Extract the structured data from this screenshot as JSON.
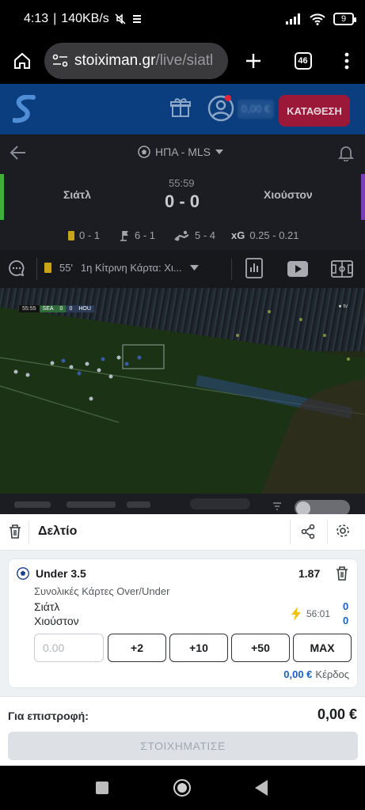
{
  "status_bar": {
    "time": "4:13",
    "speed": "140KB/s",
    "battery": "9"
  },
  "browser": {
    "url_host": "stoiximan.gr",
    "url_path": "/live/siatl",
    "tabs_count": "46"
  },
  "site_header": {
    "deposit_label": "ΚΑΤΑΘΕΣΗ",
    "balance": "0,00 €"
  },
  "event": {
    "league": "ΗΠΑ - MLS",
    "home_team": "Σιάτλ",
    "away_team": "Χιούστον",
    "time": "55:59",
    "score": "0 - 0",
    "stats": {
      "yellow_cards": "0 - 1",
      "corners": "6 - 1",
      "offsides": "5 - 4",
      "xg_label": "xG",
      "xg_value": "0.25 - 0.21"
    },
    "last_event": {
      "minute": "55'",
      "text": "1η Κίτρινη Κάρτα: Χι..."
    },
    "video_overlay": {
      "time": "55:55",
      "home": "SEA",
      "home_score": "0",
      "away_score": "0",
      "away": "HOU"
    }
  },
  "slip": {
    "title": "Δελτίο",
    "bet": {
      "selection": "Under 3.5",
      "odds": "1.87",
      "market": "Συνολικές Κάρτες Over/Under",
      "home_team": "Σιάτλ",
      "away_team": "Χιούστον",
      "live_time": "56:01",
      "home_score": "0",
      "away_score": "0",
      "stake_placeholder": "0.00",
      "quick_stakes": [
        "+2",
        "+10",
        "+50",
        "MAX"
      ],
      "potential_win_value": "0,00 €",
      "potential_win_label": "Κέρδος"
    },
    "returns_label": "Για επιστροφή:",
    "returns_value": "0,00 €",
    "place_bet_label": "ΣΤΟΙΧΗΜΑΤΙΣΕ"
  },
  "colors": {
    "brand_blue": "#0b3e7e",
    "deposit": "#9b1838",
    "accent_blue": "#1a62c4",
    "lightning": "#f2c200"
  }
}
